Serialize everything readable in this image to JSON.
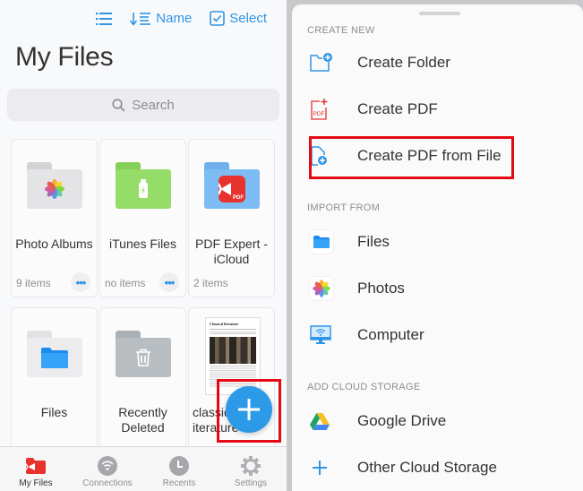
{
  "left": {
    "toolbar": {
      "list_icon": "list-icon",
      "sort_label": "Name",
      "sort_icon": "sort-down-icon",
      "select_label": "Select",
      "select_icon": "checkbox-icon"
    },
    "title": "My Files",
    "search": {
      "placeholder": "Search",
      "icon": "search-icon"
    },
    "tiles": [
      {
        "name": "Photo Albums",
        "count": "9 items",
        "icon": "photos-folder-icon",
        "has_more": true
      },
      {
        "name": "iTunes Files",
        "count": "no items",
        "icon": "itunes-folder-icon",
        "has_more": true
      },
      {
        "name": "PDF Expert - iCloud",
        "count": "2 items",
        "icon": "pdf-expert-folder-icon",
        "has_more": false
      },
      {
        "name": "Files",
        "count": "",
        "icon": "files-folder-icon"
      },
      {
        "name": "Recently Deleted",
        "count": "",
        "icon": "trash-folder-icon"
      },
      {
        "name": "classical literature",
        "count": "",
        "icon": "document-thumbnail",
        "thumb_title": "Classical literature"
      }
    ],
    "more_glyph": "•••",
    "fab": {
      "icon": "plus-icon",
      "label": "Add"
    },
    "tabbar": [
      {
        "label": "My Files",
        "icon": "my-files-icon",
        "active": true
      },
      {
        "label": "Connections",
        "icon": "wifi-icon",
        "active": false
      },
      {
        "label": "Recents",
        "icon": "clock-icon",
        "active": false
      },
      {
        "label": "Settings",
        "icon": "gear-icon",
        "active": false
      }
    ]
  },
  "sheet": {
    "sections": [
      {
        "header": "CREATE NEW",
        "items": [
          {
            "label": "Create Folder",
            "icon": "create-folder-icon"
          },
          {
            "label": "Create PDF",
            "icon": "create-pdf-icon"
          },
          {
            "label": "Create PDF from File",
            "icon": "create-pdf-from-file-icon",
            "highlighted": true
          }
        ]
      },
      {
        "header": "IMPORT FROM",
        "items": [
          {
            "label": "Files",
            "icon": "files-app-icon"
          },
          {
            "label": "Photos",
            "icon": "photos-app-icon"
          },
          {
            "label": "Computer",
            "icon": "computer-wifi-icon"
          }
        ]
      },
      {
        "header": "ADD CLOUD STORAGE",
        "items": [
          {
            "label": "Google Drive",
            "icon": "google-drive-icon"
          },
          {
            "label": "Other Cloud Storage",
            "icon": "plus-icon"
          }
        ]
      }
    ]
  },
  "colors": {
    "accent": "#2f95e6",
    "highlight_frame": "#e50914",
    "brand_red": "#e8322e",
    "text": "#333333",
    "secondary_text": "#8e8e93"
  }
}
